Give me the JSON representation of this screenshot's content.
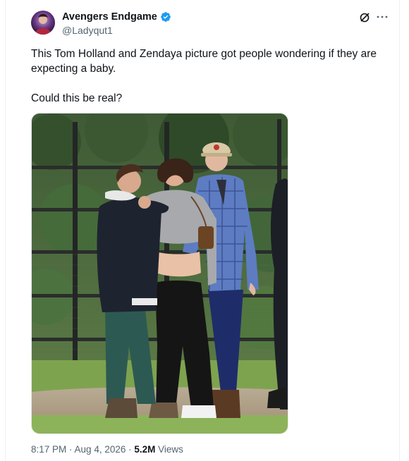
{
  "author": {
    "display_name": "Avengers Endgame",
    "handle": "@Ladyqut1",
    "verified": true
  },
  "tweet": {
    "line1": "This Tom Holland and Zendaya picture got people wondering if they are expecting a baby.",
    "line2": "Could this be real?"
  },
  "meta": {
    "time": "8:17 PM",
    "separator1": " · ",
    "date": "Aug 4, 2026",
    "separator2": " · ",
    "views_count": "5.2M",
    "views_label": " Views"
  },
  "icons": {
    "verified": "verified-badge-icon",
    "grok": "grok-icon",
    "more": "more-options-icon"
  },
  "colors": {
    "verified_blue": "#1d9bf0",
    "secondary_text": "#536471",
    "primary_text": "#0f1419"
  }
}
